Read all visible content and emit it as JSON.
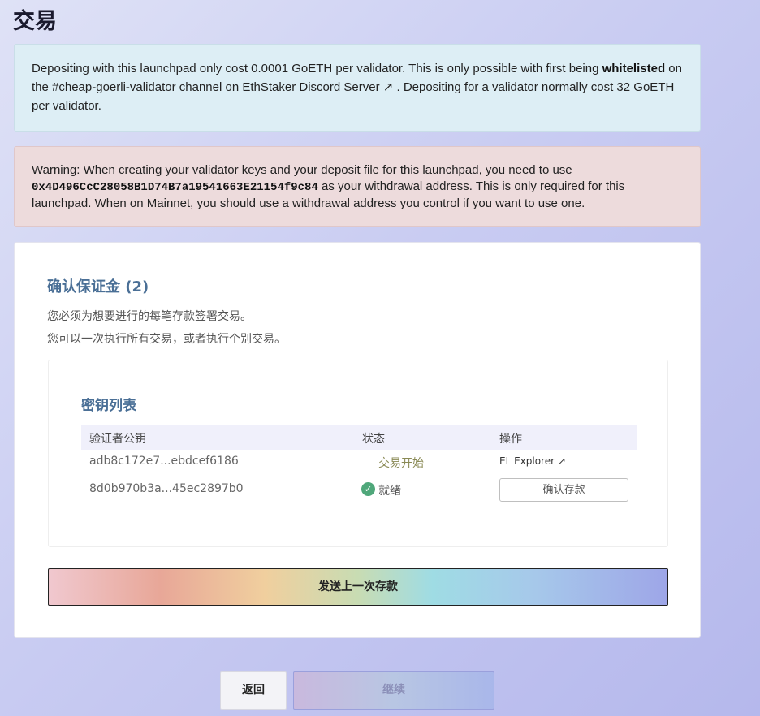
{
  "page": {
    "title": "交易"
  },
  "info_notice": {
    "text_1": "Depositing with this launchpad only cost 0.0001 GoETH per validator. This is only possible with first being ",
    "bold": "whitelisted",
    "text_2": " on the #cheap-goerli-validator channel on ",
    "link": "EthStaker Discord Server ↗",
    "text_3": " . Depositing for a validator normally cost 32 GoETH per validator."
  },
  "warning_notice": {
    "text_1": "Warning: When creating your validator keys and your deposit file for this launchpad, you need to use ",
    "address": "0x4D496CcC28058B1D74B7a19541663E21154f9c84",
    "text_2": " as your withdrawal address. This is only required for this launchpad. When on Mainnet, you should use a withdrawal address you control if you want to use one."
  },
  "card": {
    "title": "确认保证金 (2)",
    "desc_1": "您必须为想要进行的每笔存款签署交易。",
    "desc_2": "您可以一次执行所有交易，或者执行个别交易。",
    "key_list": {
      "title": "密钥列表",
      "headers": {
        "pubkey": "验证者公钥",
        "status": "状态",
        "action": "操作"
      },
      "rows": [
        {
          "pubkey": "adb8c172e7...ebdcef6186",
          "status": "交易开始",
          "action": "EL Explorer ↗"
        },
        {
          "pubkey": "8d0b970b3a...45ec2897b0",
          "status": "就绪",
          "action": "确认存款"
        }
      ]
    },
    "send_button": "发送上一次存款"
  },
  "footer": {
    "back": "返回",
    "continue": "继续"
  },
  "colors": {
    "accent_title": "#4a6f96",
    "ready_check": "#4fa77a"
  },
  "icons": {
    "ready": "check-circle-icon",
    "external": "external-link-icon"
  }
}
